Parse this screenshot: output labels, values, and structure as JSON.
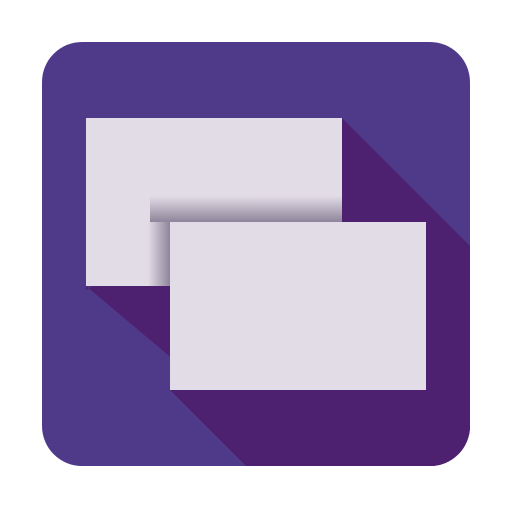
{
  "icon": {
    "name": "windows-switcher-icon",
    "colors": {
      "tile_background": "#4f3a8a",
      "long_shadow": "#4e2170",
      "window_fill": "#e2dce6",
      "window_shadow": "#2a1a40"
    }
  }
}
